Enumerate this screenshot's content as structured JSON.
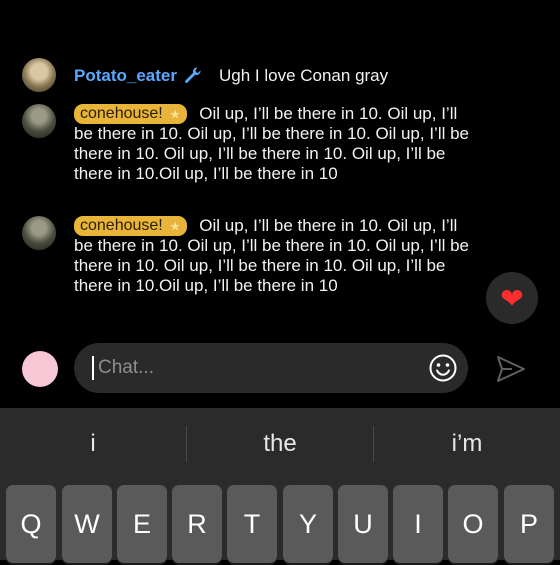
{
  "messages": [
    {
      "username": "Potato_eater",
      "badge_icon": "wrench-icon",
      "text": "Ugh I love Conan gray"
    },
    {
      "username": "conehouse!",
      "badge_icon": "star-icon",
      "text": "Oil up, I’ll be there in 10. Oil up, I’ll be there in 10. Oil up, I’ll be there in 10. Oil up, I’ll be there in 10. Oil up, I’ll be there in 10. Oil up, I’ll be there in 10.Oil up, I’ll be there in 10"
    },
    {
      "username": "conehouse!",
      "badge_icon": "star-icon",
      "text": "Oil up, I’ll be there in 10. Oil up, I’ll be there in 10. Oil up, I’ll be there in 10. Oil up, I’ll be there in 10. Oil up, I’ll be there in 10. Oil up, I’ll be there in 10.Oil up, I’ll be there in 10"
    }
  ],
  "reaction": {
    "icon": "heart-icon",
    "glyph": "❤"
  },
  "composer": {
    "placeholder": "Chat...",
    "emoji_icon": "smiley-icon",
    "send_icon": "send-icon"
  },
  "keyboard": {
    "suggestions": [
      "i",
      "the",
      "i’m"
    ],
    "keys": [
      "Q",
      "W",
      "E",
      "R",
      "T",
      "Y",
      "U",
      "I",
      "O",
      "P"
    ]
  },
  "colors": {
    "background": "#000000",
    "username_blue": "#59a9ff",
    "badge_gold": "#e8b43a",
    "keyboard_bg": "#2b2b2b",
    "key_bg": "#5a5a5a",
    "composer_avatar": "#f8c7d6",
    "heart_red": "#ff2d2d"
  }
}
